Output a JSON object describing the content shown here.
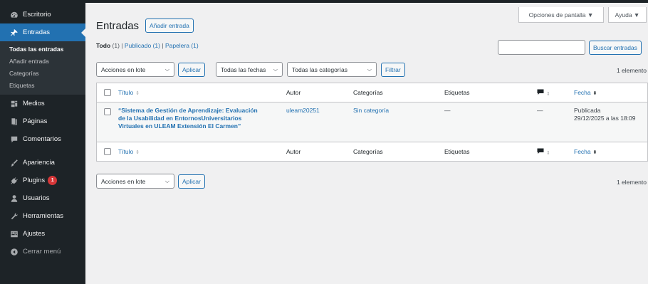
{
  "sidebar": {
    "items": [
      {
        "label": "Escritorio",
        "icon": "dashboard-icon"
      },
      {
        "label": "Entradas",
        "icon": "pushpin-icon"
      },
      {
        "label": "Medios",
        "icon": "media-icon"
      },
      {
        "label": "Páginas",
        "icon": "pages-icon"
      },
      {
        "label": "Comentarios",
        "icon": "comments-icon"
      },
      {
        "label": "Apariencia",
        "icon": "appearance-icon"
      },
      {
        "label": "Plugins",
        "icon": "plugins-icon",
        "badge": "1"
      },
      {
        "label": "Usuarios",
        "icon": "users-icon"
      },
      {
        "label": "Herramientas",
        "icon": "tools-icon"
      },
      {
        "label": "Ajustes",
        "icon": "settings-icon"
      },
      {
        "label": "Cerrar menú",
        "icon": "collapse-icon"
      }
    ],
    "submenu": [
      "Todas las entradas",
      "Añadir entrada",
      "Categorías",
      "Etiquetas"
    ]
  },
  "header": {
    "screen_options": "Opciones de pantalla ▼",
    "help": "Ayuda ▼",
    "title": "Entradas",
    "add_new": "Añadir entrada"
  },
  "filters": {
    "all": "Todo",
    "all_count": "(1)",
    "published": "Publicado (1)",
    "trash": "Papelera (1)",
    "sep": "|"
  },
  "search": {
    "button": "Buscar entradas",
    "value": ""
  },
  "tablenav": {
    "bulk_actions": "Acciones en lote",
    "apply": "Aplicar",
    "dates": "Todas las fechas",
    "categories": "Todas las categorías",
    "filter": "Filtrar",
    "count": "1 elemento"
  },
  "table": {
    "columns": {
      "title": "Título",
      "author": "Autor",
      "categories": "Categorías",
      "tags": "Etiquetas",
      "date": "Fecha"
    },
    "rows": [
      {
        "title_1": "“Sistema de Gestión de Aprendizaje: Evaluación",
        "title_2": "de la Usabilidad en EntornosUniversitarios",
        "title_3": "Virtuales en ULEAM Extensión El Carmen”",
        "author": "uleam20251",
        "categories": "Sin categoría",
        "tags": "—",
        "comments": "—",
        "status": "Publicada",
        "date": "29/12/2025 a las 18:09"
      }
    ]
  },
  "colors": {
    "accent": "#2271b1",
    "sidebar": "#1d2327",
    "badge": "#d63638"
  }
}
